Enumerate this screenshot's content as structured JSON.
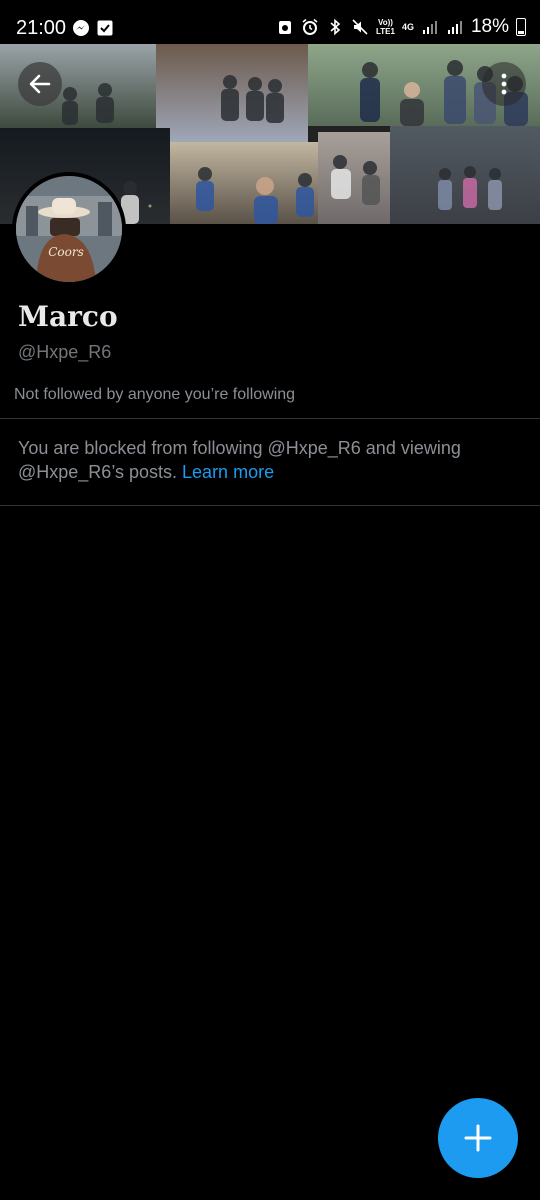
{
  "status_bar": {
    "time": "21:00",
    "network_volte": "Vo))\nLTE1",
    "network_4g": "4G",
    "battery_percent": "18%",
    "icons": [
      "messenger-icon",
      "checklist-icon",
      "vpn-icon",
      "alarm-icon",
      "bluetooth-icon",
      "mute-icon",
      "signal-icon",
      "battery-icon"
    ]
  },
  "header": {
    "back_icon": "arrow-left-icon",
    "more_icon": "more-vertical-icon"
  },
  "profile": {
    "display_name": "Marco",
    "handle": "@Hxpe_R6",
    "followed_by": "Not followed by anyone you’re following",
    "blocked_text": "You are blocked from following @Hxpe_R6 and viewing @Hxpe_R6’s posts.",
    "learn_more": "Learn more",
    "avatar_hat_text": "Coors"
  },
  "fab": {
    "icon": "plus-icon"
  },
  "colors": {
    "background": "#000000",
    "text_primary": "#e7e9ea",
    "text_secondary": "#71767b",
    "accent": "#1d9bf0",
    "divider": "#2f3336"
  }
}
